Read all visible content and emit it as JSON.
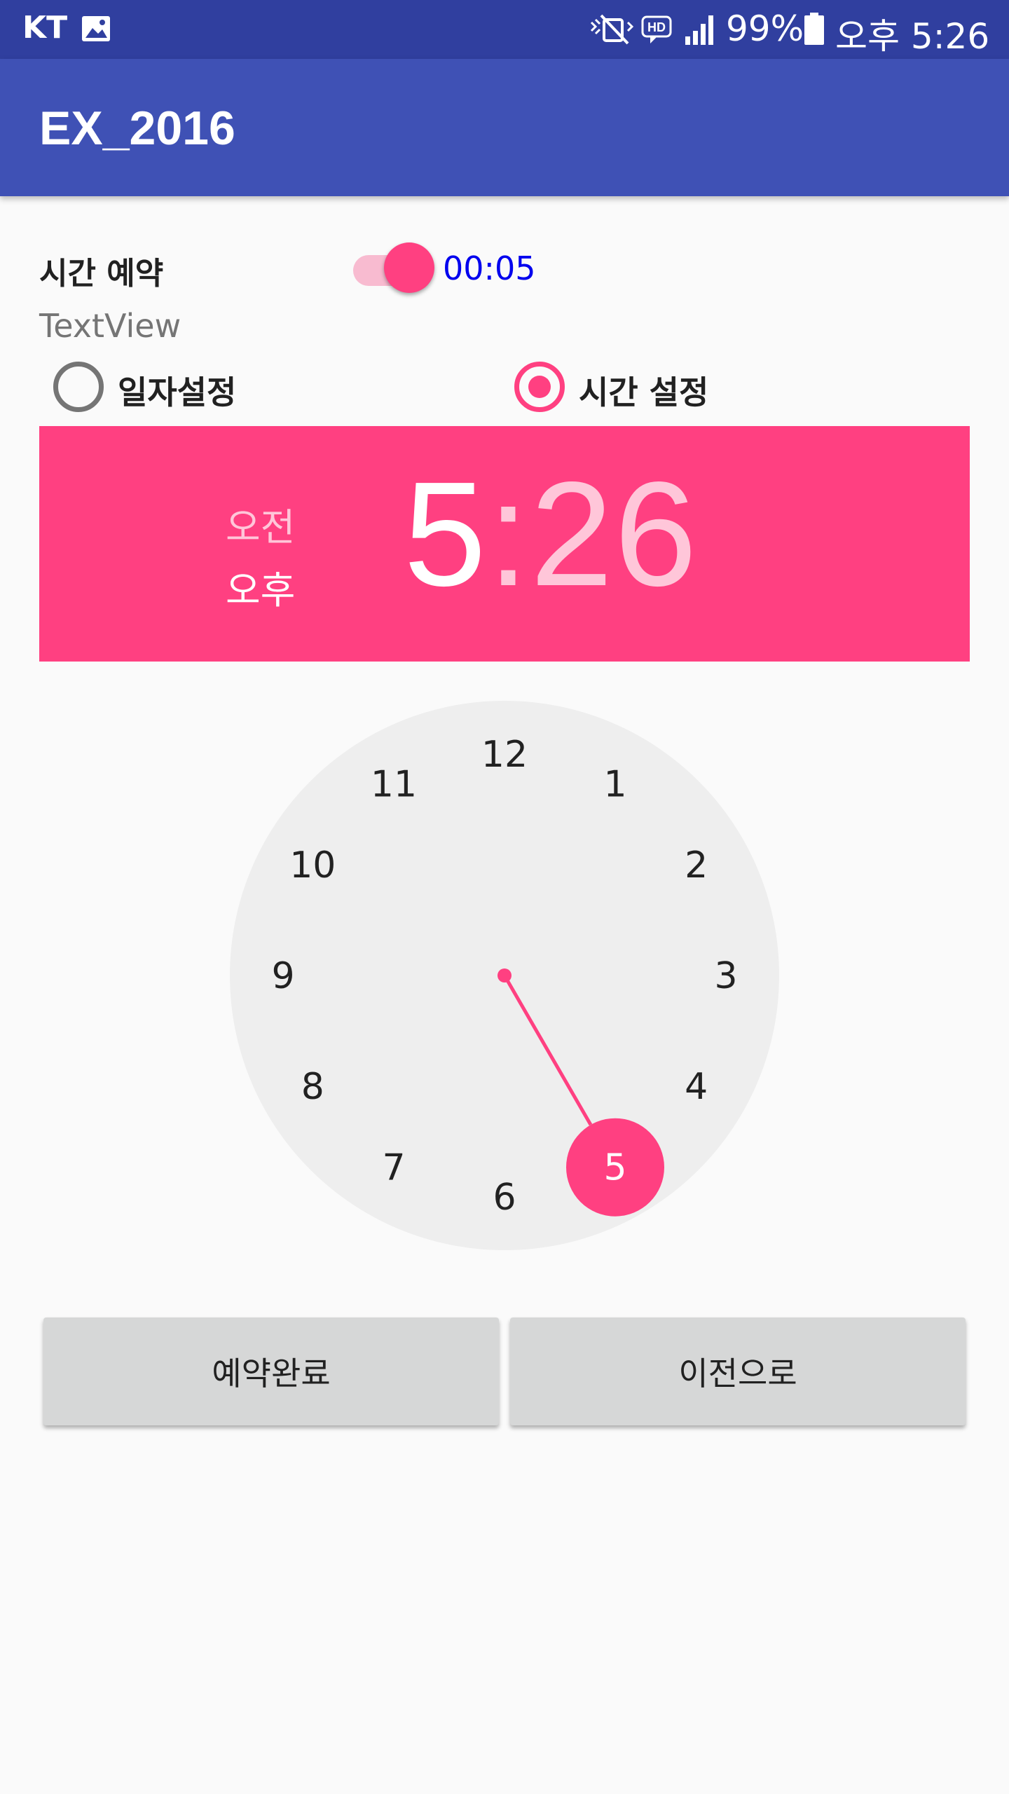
{
  "status_bar": {
    "carrier": "KT",
    "battery_percent": "99%",
    "time": "오후 5:26",
    "icons": [
      "gallery-icon",
      "mute-icon",
      "hd-icon",
      "signal-icon",
      "battery-icon"
    ]
  },
  "app_bar": {
    "title": "EX_2016"
  },
  "reservation": {
    "label": "시간 예약",
    "switch_on": true,
    "timer": "00:05"
  },
  "textview": "TextView",
  "radios": [
    {
      "label": "일자설정",
      "checked": false
    },
    {
      "label": "시간 설정",
      "checked": true
    }
  ],
  "time_picker": {
    "am_label": "오전",
    "pm_label": "오후",
    "hour": "5",
    "colon": ":",
    "minute": "26",
    "selected_period": "pm",
    "selected_hour": 5,
    "clock_numbers": [
      "12",
      "1",
      "2",
      "3",
      "4",
      "5",
      "6",
      "7",
      "8",
      "9",
      "10",
      "11"
    ]
  },
  "buttons": {
    "complete": "예약완료",
    "previous": "이전으로"
  },
  "colors": {
    "status_bar": "#303f9f",
    "app_bar": "#3f51b5",
    "accent": "#ff4081",
    "accent_light": "#f8bbd0",
    "clock_face": "#eeeeee",
    "button": "#d6d7d7"
  }
}
